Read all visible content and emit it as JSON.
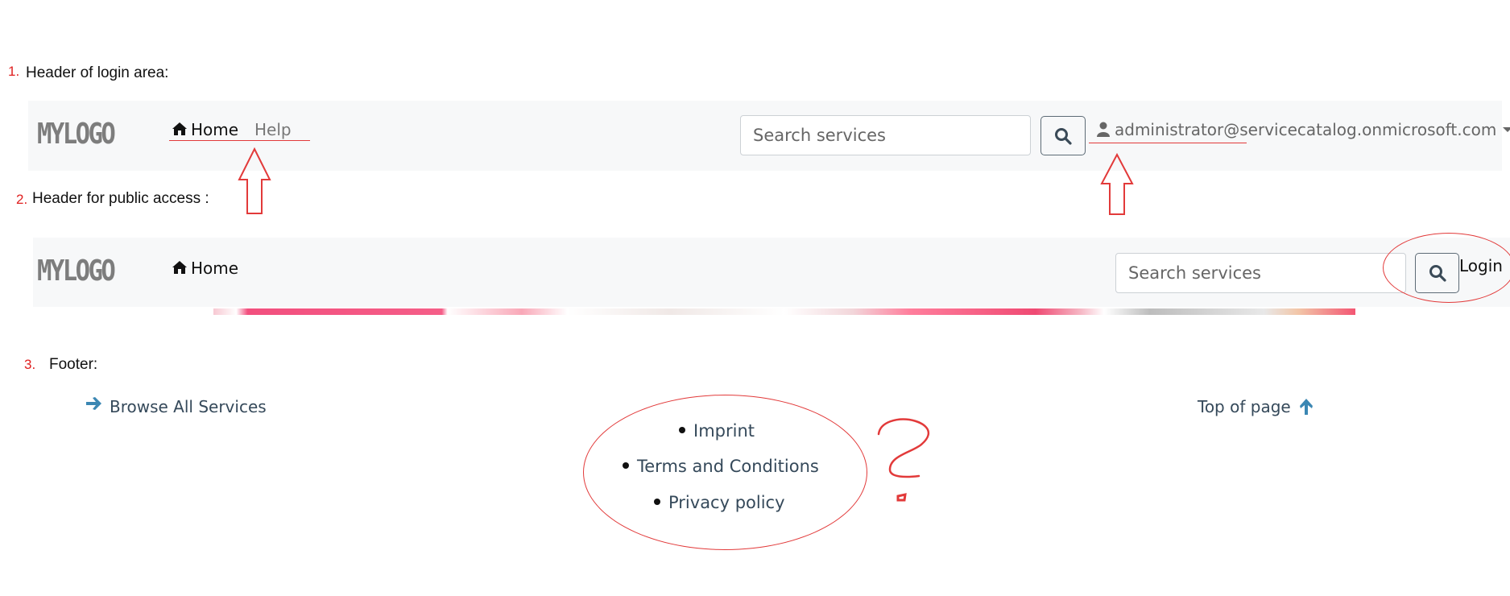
{
  "sections": {
    "login": {
      "number": "1.",
      "caption": "Header of login area:"
    },
    "public": {
      "number": "2.",
      "caption": "Header for public access :"
    },
    "footer": {
      "number": "3.",
      "caption": "Footer:"
    }
  },
  "header_login": {
    "logo": "MYLOGO",
    "nav": {
      "home": "Home",
      "help": "Help"
    },
    "search": {
      "placeholder": "Search services"
    },
    "user": "administrator@servicecatalog.onmicrosoft.com"
  },
  "header_public": {
    "logo": "MYLOGO",
    "nav": {
      "home": "Home"
    },
    "search": {
      "placeholder": "Search services"
    },
    "login": "Login"
  },
  "footer": {
    "browse": "Browse All Services",
    "top": "Top of page",
    "links": [
      "Imprint",
      "Terms and Conditions",
      "Privacy policy"
    ]
  },
  "annotation": {
    "question_mark": "?"
  },
  "colors": {
    "annotation": "#e23a3a",
    "navbar_bg": "#f7f8f9",
    "footer_link": "#35495a",
    "icon_blue": "#3b87b3"
  }
}
